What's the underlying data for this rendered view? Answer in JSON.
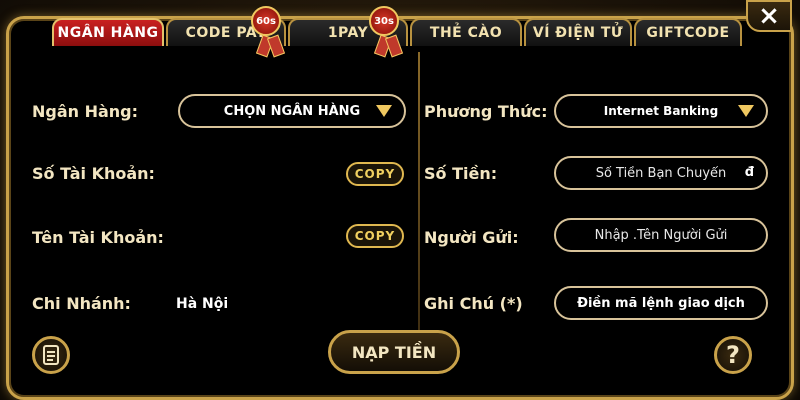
{
  "tabs": [
    {
      "label": "NGÂN HÀNG",
      "active": true
    },
    {
      "label": "CODE PAY",
      "badge": "60s"
    },
    {
      "label": "1PAY",
      "badge": "30s"
    },
    {
      "label": "THẺ CÀO"
    },
    {
      "label": "VÍ ĐIỆN TỬ"
    },
    {
      "label": "GIFTCODE"
    }
  ],
  "close_icon": "×",
  "left": {
    "bank_label": "Ngân Hàng:",
    "bank_select": "CHỌN NGÂN HÀNG",
    "account_number_label": "Số Tài Khoản:",
    "account_name_label": "Tên Tài Khoản:",
    "branch_label": "Chi Nhánh:",
    "branch_value": "Hà Nội",
    "copy_label": "COPY"
  },
  "right": {
    "method_label": "Phương Thức:",
    "method_select": "Internet Banking",
    "amount_label": "Số Tiền:",
    "amount_placeholder": "Số Tiền Bạn Chuyển",
    "amount_unit": "đ",
    "sender_label": "Người Gửi:",
    "sender_placeholder": "Nhập .Tên Người Gửi",
    "note_label": "Ghi Chú (*)",
    "note_value": "Điền mã lệnh giao dịch"
  },
  "submit_label": "NẠP TIỀN",
  "help_icon": "?",
  "colors": {
    "gold": "#c9a24a",
    "active_tab": "#c92020",
    "text": "#f3e6c2"
  }
}
